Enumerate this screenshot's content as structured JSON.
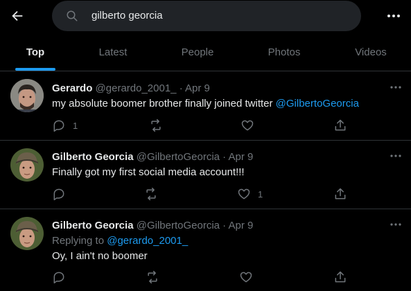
{
  "search": {
    "query": "gilberto georcia"
  },
  "tabs": [
    {
      "label": "Top"
    },
    {
      "label": "Latest"
    },
    {
      "label": "People"
    },
    {
      "label": "Photos"
    },
    {
      "label": "Videos"
    }
  ],
  "tweets": [
    {
      "name": "Gerardo",
      "handle": "@gerardo_2001_",
      "sep": "·",
      "date": "Apr 9",
      "text": "my absolute boomer brother finally joined twitter ",
      "mention": "@GilbertoGeorcia",
      "reply_count": "1",
      "like_count": ""
    },
    {
      "name": "Gilberto Georcia",
      "handle": "@GilbertoGeorcia",
      "sep": "·",
      "date": "Apr 9",
      "text": "Finally got my first social media account!!!",
      "reply_count": "",
      "like_count": "1"
    },
    {
      "name": "Gilberto Georcia",
      "handle": "@GilbertoGeorcia",
      "sep": "·",
      "date": "Apr 9",
      "replying_prefix": "Replying to ",
      "replying_to": "@gerardo_2001_",
      "text": "Oy, I ain't no boomer",
      "reply_count": "",
      "like_count": ""
    }
  ],
  "colors": {
    "accent": "#1d9bf0",
    "muted": "#71767b",
    "text": "#e7e9ea",
    "background": "#000000"
  }
}
